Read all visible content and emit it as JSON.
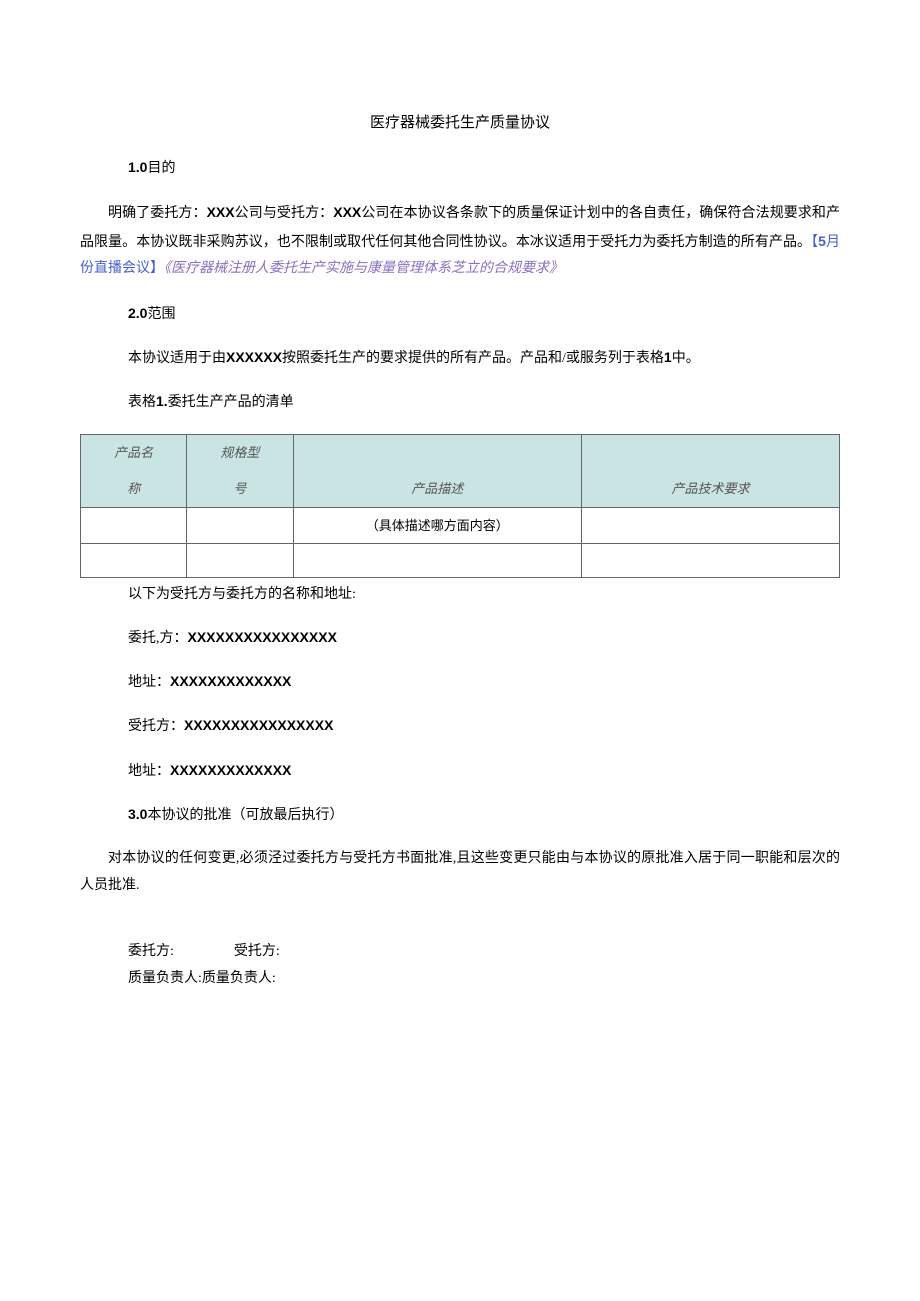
{
  "title": "医疗器械委托生产质量协议",
  "s1": {
    "num": "1.0",
    "heading": "目的",
    "para_before_links": "明确了委托方：",
    "xxx1": "XXX",
    "mid1": "公司与受托方：",
    "xxx2": "XXX",
    "mid2": "公司在本协议各条款下的质量保证计划中的各自责任，确保符合法规要求和产品限量。本协议既非采购苏议，也不限制或取代任何其他合同性协议。本冰议适用于受托力为委托方制造的所有产品。",
    "link1_prefix": "【",
    "link1_num": "5",
    "link1_rest": "月份直播会议】",
    "link2": "《医疗器械注册人委托生产实施与康量管理体系芝立的合规要求》"
  },
  "s2": {
    "num": "2.0",
    "heading": "范围",
    "para_before": "本协议适用于由",
    "xxxxxx": "XXXXXX",
    "para_mid": "按照委托生产的要求提供的所有产品。产品和/或服务列于表格",
    "one": "1",
    "para_after": "中。",
    "table_caption_prefix": "表格",
    "table_caption_num": "1.",
    "table_caption_rest": "委托生产产品的清单"
  },
  "table": {
    "headers": {
      "c1a": "产品名",
      "c1b": "称",
      "c2a": "规格型",
      "c2b": "号",
      "c3": "产品描述",
      "c4": "产品技术要求"
    },
    "rows": [
      {
        "c1": "",
        "c2": "",
        "c3": "（具体描述哪方面内容）",
        "c4": ""
      },
      {
        "c1": "",
        "c2": "",
        "c3": "",
        "c4": ""
      }
    ]
  },
  "after_table": "以下为受托方与委托方的名称和地址:",
  "parties": {
    "p1_label": "委托,方：",
    "p1_value": "XXXXXXXXXXXXXXXX",
    "p2_label": "地址：",
    "p2_value": "XXXXXXXXXXXXX",
    "p3_label": "受托方：",
    "p3_value": "XXXXXXXXXXXXXXXX",
    "p4_label": "地址：",
    "p4_value": "XXXXXXXXXXXXX"
  },
  "s3": {
    "num": "3.0",
    "heading": "本协议的批准（可放最后执行）",
    "para": "对本协议的任何变更,必须泾过委托方与受托方书面批准,且这些变更只能由与本协议的原批准入居于同一职能和层次的人员批准."
  },
  "sig": {
    "row1_a": "委托方:",
    "row1_b": "受托方:",
    "row2_a": "质量负责人:",
    "row2_b": "质量负责人:"
  }
}
